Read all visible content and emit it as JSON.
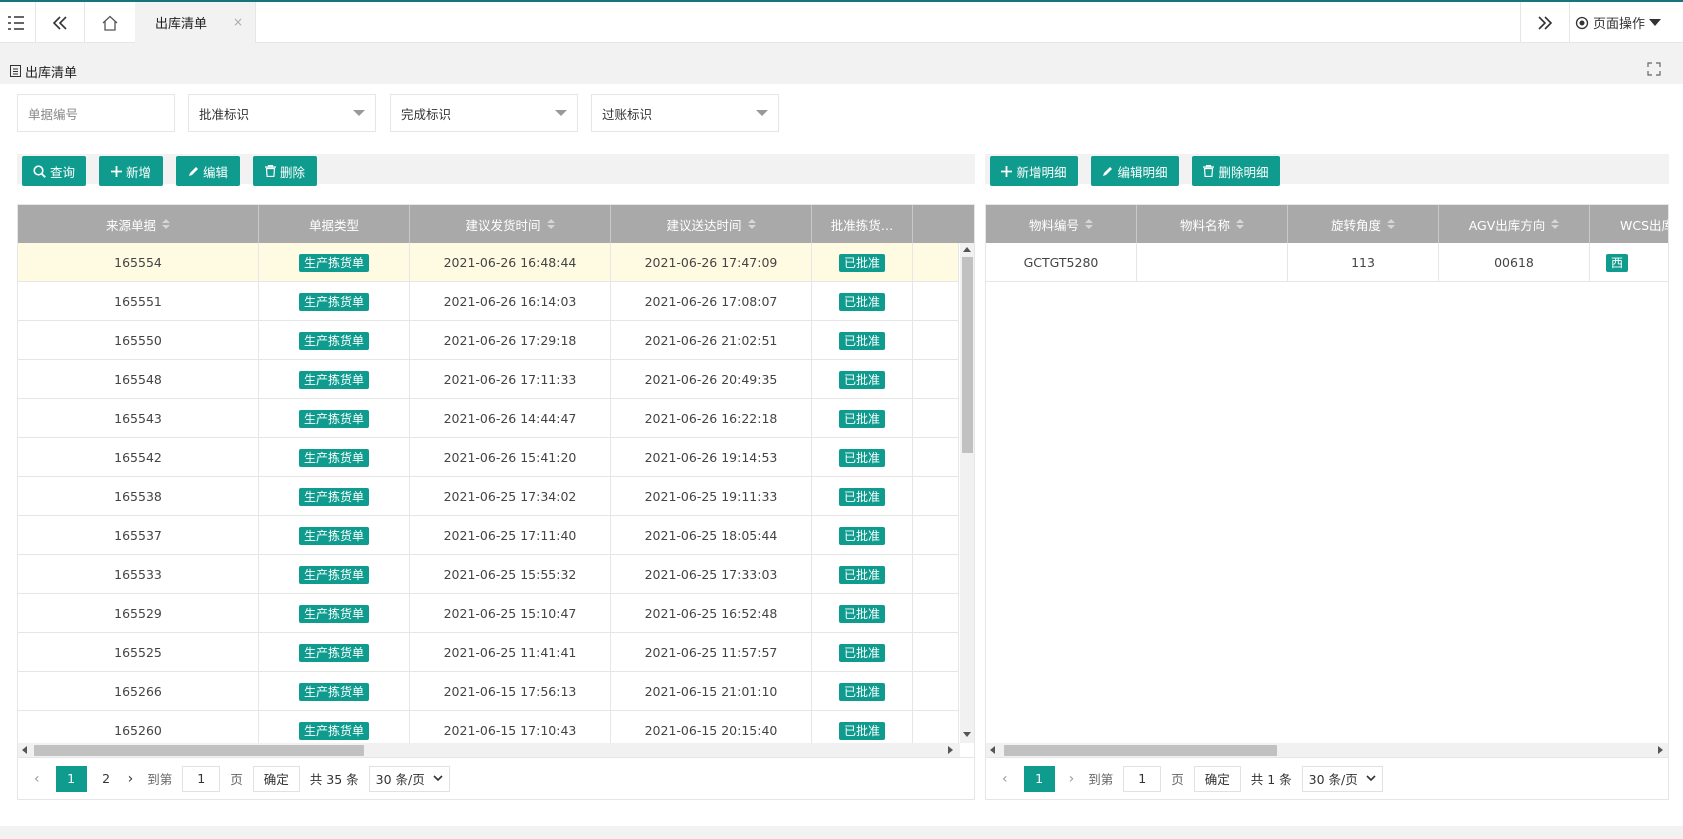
{
  "topbar": {
    "tab_label": "出库清单",
    "tab_close": "×",
    "page_ops_label": "页面操作"
  },
  "panel": {
    "title": "出库清单"
  },
  "filters": {
    "doc_no_placeholder": "单据编号",
    "approve_label": "批准标识",
    "complete_label": "完成标识",
    "post_label": "过账标识"
  },
  "left_toolbar": {
    "query": "查询",
    "add": "新增",
    "edit": "编辑",
    "delete": "删除"
  },
  "right_toolbar": {
    "add_detail": "新增明细",
    "edit_detail": "编辑明细",
    "delete_detail": "删除明细"
  },
  "left_table": {
    "columns": [
      "来源单据",
      "单据类型",
      "建议发货时间",
      "建议送达时间",
      "批准拣货…",
      ""
    ],
    "rows": [
      {
        "source": "165554",
        "type": "生产拣货单",
        "ship": "2021-06-26 16:48:44",
        "arrive": "2021-06-26 17:47:09",
        "approved": "已批准"
      },
      {
        "source": "165551",
        "type": "生产拣货单",
        "ship": "2021-06-26 16:14:03",
        "arrive": "2021-06-26 17:08:07",
        "approved": "已批准"
      },
      {
        "source": "165550",
        "type": "生产拣货单",
        "ship": "2021-06-26 17:29:18",
        "arrive": "2021-06-26 21:02:51",
        "approved": "已批准"
      },
      {
        "source": "165548",
        "type": "生产拣货单",
        "ship": "2021-06-26 17:11:33",
        "arrive": "2021-06-26 20:49:35",
        "approved": "已批准"
      },
      {
        "source": "165543",
        "type": "生产拣货单",
        "ship": "2021-06-26 14:44:47",
        "arrive": "2021-06-26 16:22:18",
        "approved": "已批准"
      },
      {
        "source": "165542",
        "type": "生产拣货单",
        "ship": "2021-06-26 15:41:20",
        "arrive": "2021-06-26 19:14:53",
        "approved": "已批准"
      },
      {
        "source": "165538",
        "type": "生产拣货单",
        "ship": "2021-06-25 17:34:02",
        "arrive": "2021-06-25 19:11:33",
        "approved": "已批准"
      },
      {
        "source": "165537",
        "type": "生产拣货单",
        "ship": "2021-06-25 17:11:40",
        "arrive": "2021-06-25 18:05:44",
        "approved": "已批准"
      },
      {
        "source": "165533",
        "type": "生产拣货单",
        "ship": "2021-06-25 15:55:32",
        "arrive": "2021-06-25 17:33:03",
        "approved": "已批准"
      },
      {
        "source": "165529",
        "type": "生产拣货单",
        "ship": "2021-06-25 15:10:47",
        "arrive": "2021-06-25 16:52:48",
        "approved": "已批准"
      },
      {
        "source": "165525",
        "type": "生产拣货单",
        "ship": "2021-06-25 11:41:41",
        "arrive": "2021-06-25 11:57:57",
        "approved": "已批准"
      },
      {
        "source": "165266",
        "type": "生产拣货单",
        "ship": "2021-06-15 17:56:13",
        "arrive": "2021-06-15 21:01:10",
        "approved": "已批准"
      },
      {
        "source": "165260",
        "type": "生产拣货单",
        "ship": "2021-06-15 17:10:43",
        "arrive": "2021-06-15 20:15:40",
        "approved": "已批准"
      }
    ]
  },
  "right_table": {
    "columns": [
      "物料编号",
      "物料名称",
      "旋转角度",
      "AGV出库方向",
      "WCS出库"
    ],
    "rows": [
      {
        "code": "GCTGT5280",
        "name": "",
        "angle": "113",
        "agv": "00618",
        "wcs": "西"
      }
    ]
  },
  "left_pager": {
    "current": "1",
    "next_page": "2",
    "goto_label": "到第",
    "goto_value": "1",
    "page_unit": "页",
    "confirm": "确定",
    "total": "共 35 条",
    "per_page": "30 条/页"
  },
  "right_pager": {
    "current": "1",
    "goto_label": "到第",
    "goto_value": "1",
    "page_unit": "页",
    "confirm": "确定",
    "total": "共 1 条",
    "per_page": "30 条/页"
  },
  "colors": {
    "accent": "#0f9b8e",
    "header_gray": "#a9a9a9",
    "selected_row": "#fffbe3"
  }
}
